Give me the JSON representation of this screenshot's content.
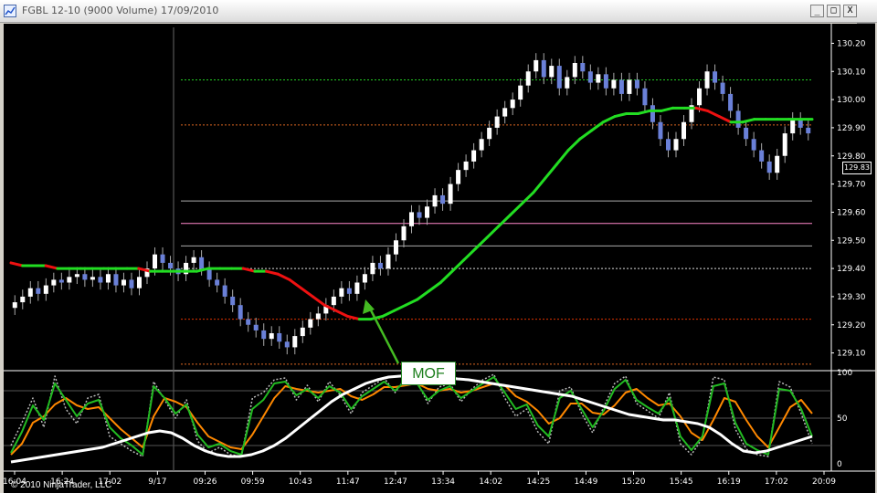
{
  "window": {
    "title": "FGBL 12-10 (9000 Volume)  17/09/2010",
    "minimize_label": "_",
    "maximize_label": "□",
    "close_label": "X",
    "dropdown_label": "▼"
  },
  "icons": {
    "app": "chart-app-icon",
    "minimize": "minimize-icon",
    "maximize": "maximize-icon",
    "close": "close-icon",
    "dropdown": "chevron-down-icon"
  },
  "colors": {
    "background": "#000000",
    "up_candle": "#ffffff",
    "down_candle": "#6a80d8",
    "ema_up": "#22dd22",
    "ema_down": "#ee1111",
    "level_green": "#22cc22",
    "level_orange": "#dd6622",
    "level_magenta": "#ff88cc",
    "level_grey": "#aaaaaa",
    "stoch_green": "#22bb22",
    "stoch_orange": "#ff8800",
    "stoch_dotted": "#bbbbbb",
    "slow_line": "#ffffff"
  },
  "annotation": {
    "label": "MOF"
  },
  "last_price": "129.83",
  "copyright": "© 2010 NinjaTrader, LLC",
  "chart_data": {
    "type": "candlestick",
    "price_axis_ticks": [
      "130.20",
      "130.10",
      "130.00",
      "129.90",
      "129.80",
      "129.70",
      "129.60",
      "129.50",
      "129.40",
      "129.30",
      "129.20",
      "129.10"
    ],
    "price_ylim": [
      129.05,
      130.25
    ],
    "time_axis_ticks": [
      "16:04",
      "16:24",
      "17:02",
      "9/17",
      "09:26",
      "09:59",
      "10:43",
      "11:47",
      "12:47",
      "13:34",
      "14:02",
      "14:25",
      "14:49",
      "15:20",
      "15:45",
      "16:19",
      "17:02",
      "20:09"
    ],
    "oscillator_ticks": [
      "100",
      "50",
      "0"
    ],
    "oscillator_ylim": [
      0,
      100
    ],
    "horizontal_levels": [
      {
        "value": 130.07,
        "color": "#22cc22",
        "style": "dotted"
      },
      {
        "value": 129.91,
        "color": "#dd6622",
        "style": "dotted"
      },
      {
        "value": 129.64,
        "color": "#aaaaaa",
        "style": "solid"
      },
      {
        "value": 129.56,
        "color": "#ff88cc",
        "style": "solid"
      },
      {
        "value": 129.48,
        "color": "#aaaaaa",
        "style": "solid"
      },
      {
        "value": 129.4,
        "color": "#dddddd",
        "style": "dotted"
      },
      {
        "value": 129.22,
        "color": "#dd3300",
        "style": "dotted"
      },
      {
        "value": 129.06,
        "color": "#dd6622",
        "style": "dotted"
      }
    ],
    "close": [
      129.28,
      129.3,
      129.33,
      129.31,
      129.34,
      129.36,
      129.35,
      129.37,
      129.38,
      129.36,
      129.37,
      129.35,
      129.38,
      129.34,
      129.36,
      129.33,
      129.37,
      129.4,
      129.45,
      129.42,
      129.4,
      129.38,
      129.42,
      129.44,
      129.4,
      129.36,
      129.34,
      129.3,
      129.27,
      129.22,
      129.2,
      129.18,
      129.15,
      129.17,
      129.14,
      129.12,
      129.16,
      129.19,
      129.22,
      129.24,
      129.27,
      129.3,
      129.33,
      129.31,
      129.35,
      129.38,
      129.42,
      129.4,
      129.45,
      129.5,
      129.55,
      129.6,
      129.58,
      129.62,
      129.66,
      129.63,
      129.7,
      129.75,
      129.78,
      129.82,
      129.86,
      129.9,
      129.94,
      129.97,
      130.0,
      130.05,
      130.1,
      130.14,
      130.08,
      130.12,
      130.04,
      130.08,
      130.13,
      130.1,
      130.06,
      130.09,
      130.04,
      130.07,
      130.02,
      130.07,
      130.04,
      129.98,
      129.92,
      129.86,
      129.82,
      129.86,
      129.92,
      129.98,
      130.04,
      130.1,
      130.06,
      130.02,
      129.96,
      129.9,
      129.86,
      129.82,
      129.78,
      129.74,
      129.8,
      129.88,
      129.93,
      129.9,
      129.88
    ],
    "ema_value": [
      129.42,
      129.41,
      129.41,
      129.41,
      129.4,
      129.4,
      129.4,
      129.4,
      129.4,
      129.4,
      129.4,
      129.4,
      129.39,
      129.39,
      129.39,
      129.39,
      129.39,
      129.4,
      129.4,
      129.4,
      129.4,
      129.39,
      129.39,
      129.38,
      129.36,
      129.33,
      129.3,
      129.27,
      129.25,
      129.23,
      129.22,
      129.22,
      129.23,
      129.25,
      129.27,
      129.29,
      129.32,
      129.35,
      129.39,
      129.43,
      129.47,
      129.51,
      129.55,
      129.59,
      129.63,
      129.67,
      129.72,
      129.77,
      129.82,
      129.86,
      129.89,
      129.92,
      129.94,
      129.95,
      129.95,
      129.96,
      129.96,
      129.97,
      129.97,
      129.97,
      129.96,
      129.94,
      129.92,
      129.92,
      129.93,
      129.93,
      129.93,
      129.93,
      129.93,
      129.93
    ],
    "stochastic_fast": [
      12,
      35,
      64,
      48,
      88,
      70,
      52,
      66,
      70,
      40,
      28,
      20,
      10,
      85,
      72,
      55,
      65,
      32,
      18,
      22,
      14,
      10,
      60,
      70,
      88,
      90,
      75,
      82,
      72,
      85,
      78,
      60,
      74,
      82,
      90,
      80,
      92,
      88,
      70,
      80,
      85,
      72,
      80,
      88,
      95,
      78,
      60,
      65,
      42,
      30,
      72,
      80,
      60,
      40,
      58,
      82,
      92,
      70,
      62,
      55,
      72,
      30,
      15,
      30,
      85,
      88,
      45,
      22,
      15,
      10,
      82,
      80,
      60,
      30
    ],
    "stochastic_slow": [
      10,
      22,
      45,
      52,
      65,
      72,
      64,
      60,
      62,
      50,
      38,
      28,
      18,
      52,
      72,
      68,
      62,
      45,
      30,
      24,
      18,
      16,
      32,
      52,
      72,
      85,
      82,
      80,
      78,
      80,
      82,
      74,
      70,
      76,
      84,
      84,
      86,
      88,
      82,
      80,
      82,
      78,
      80,
      84,
      88,
      86,
      74,
      68,
      58,
      44,
      50,
      66,
      66,
      56,
      54,
      64,
      78,
      82,
      72,
      64,
      66,
      52,
      34,
      26,
      48,
      72,
      68,
      48,
      30,
      18,
      40,
      62,
      70,
      55
    ],
    "stochastic_dotted": [
      20,
      45,
      72,
      40,
      96,
      60,
      44,
      72,
      76,
      30,
      22,
      14,
      8,
      90,
      70,
      50,
      70,
      25,
      12,
      18,
      10,
      8,
      72,
      78,
      92,
      94,
      70,
      86,
      68,
      90,
      75,
      55,
      78,
      86,
      94,
      78,
      95,
      90,
      66,
      84,
      88,
      68,
      82,
      92,
      98,
      72,
      52,
      60,
      35,
      22,
      80,
      84,
      55,
      34,
      62,
      88,
      96,
      66,
      58,
      50,
      78,
      22,
      10,
      28,
      95,
      92,
      38,
      16,
      10,
      8,
      90,
      84,
      55,
      22
    ],
    "slow_white_line": [
      2,
      4,
      6,
      8,
      10,
      12,
      14,
      16,
      18,
      22,
      26,
      30,
      34,
      36,
      34,
      28,
      20,
      14,
      10,
      8,
      8,
      10,
      14,
      20,
      28,
      38,
      48,
      58,
      68,
      76,
      82,
      88,
      92,
      95,
      96,
      97,
      97,
      96,
      95,
      93,
      92,
      90,
      88,
      86,
      84,
      82,
      80,
      78,
      76,
      74,
      70,
      66,
      62,
      58,
      54,
      52,
      50,
      48,
      48,
      46,
      44,
      40,
      32,
      22,
      14,
      12,
      14,
      18,
      22,
      26,
      30
    ]
  }
}
